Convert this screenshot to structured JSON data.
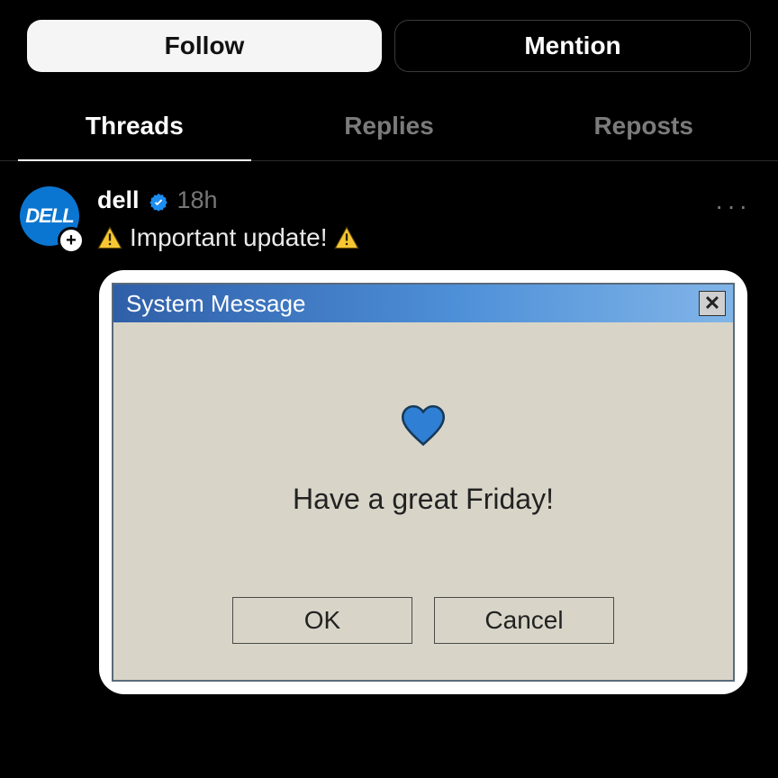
{
  "actions": {
    "follow": "Follow",
    "mention": "Mention"
  },
  "tabs": {
    "threads": "Threads",
    "replies": "Replies",
    "reposts": "Reposts"
  },
  "post": {
    "username": "dell",
    "avatar_text": "DELL",
    "timestamp": "18h",
    "text": "Important update!",
    "more": "···"
  },
  "dialog": {
    "title": "System Message",
    "message": "Have a great Friday!",
    "ok": "OK",
    "cancel": "Cancel",
    "close": "✕"
  },
  "icons": {
    "add": "+"
  }
}
